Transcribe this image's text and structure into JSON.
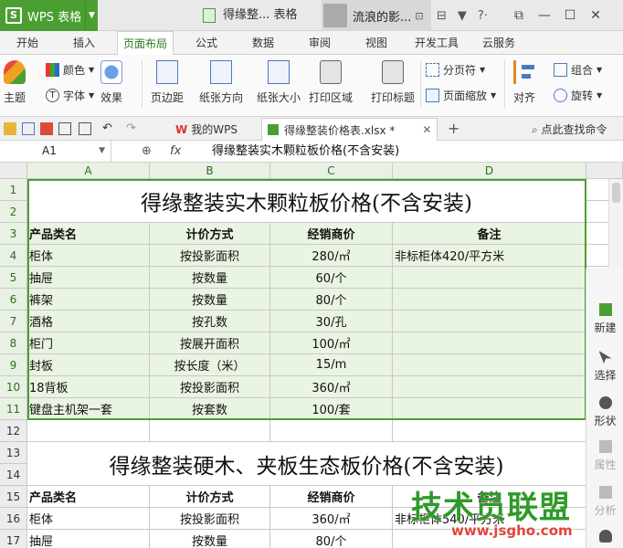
{
  "titlebar": {
    "app_label": "WPS 表格",
    "doc_title": "得缘整... 表格",
    "user_name": "流浪的影...",
    "colors": {
      "brand": "#4b9f32"
    }
  },
  "menu": {
    "tabs": [
      "开始",
      "插入",
      "页面布局",
      "公式",
      "数据",
      "审阅",
      "视图",
      "开发工具",
      "云服务"
    ],
    "active_tab": "页面布局"
  },
  "ribbon": {
    "theme": "主题",
    "colors": "颜色",
    "fonts": "字体",
    "effects": "效果",
    "margins": "页边距",
    "orientation": "纸张方向",
    "paper_size": "纸张大小",
    "print_area": "打印区域",
    "print_titles": "打印标题",
    "page_break": "分页符",
    "page_zoom": "页面缩放",
    "align": "对齐",
    "group": "组合",
    "rotate": "旋转"
  },
  "doc_tabs": {
    "home": "我的WPS",
    "file": "得缘整装价格表.xlsx *",
    "search": "点此查找命令"
  },
  "formula": {
    "name_box": "A1",
    "content": "得缘整装实木颗粒板价格(不含安装)",
    "fx": "fx"
  },
  "grid": {
    "columns": [
      "A",
      "B",
      "C",
      "D"
    ],
    "rows": [
      "1",
      "2",
      "3",
      "4",
      "5",
      "6",
      "7",
      "8",
      "9",
      "10",
      "11",
      "12",
      "13",
      "14",
      "15",
      "16",
      "17"
    ],
    "title1": "得缘整装实木颗粒板价格(不含安装)",
    "title2": "得缘整装硬木、夹板生态板价格(不含安装)",
    "headers": [
      "产品类名",
      "计价方式",
      "经销商价",
      "备注"
    ],
    "table1": [
      [
        "柜体",
        "按投影面积",
        "280/㎡",
        "非标柜体420/平方米"
      ],
      [
        "抽屉",
        "按数量",
        "60/个",
        ""
      ],
      [
        "裤架",
        "按数量",
        "80/个",
        ""
      ],
      [
        "酒格",
        "按孔数",
        "30/孔",
        ""
      ],
      [
        "柜门",
        "按展开面积",
        "100/㎡",
        ""
      ],
      [
        "封板",
        "按长度（米）",
        "15/m",
        ""
      ],
      [
        "18背板",
        "按投影面积",
        "360/㎡",
        ""
      ],
      [
        "键盘主机架一套",
        "按套数",
        "100/套",
        ""
      ]
    ],
    "table2": [
      [
        "柜体",
        "按投影面积",
        "360/㎡",
        "非标柜体540/平方米"
      ],
      [
        "抽屉",
        "按数量",
        "80/个",
        ""
      ]
    ]
  },
  "side_panel": {
    "items": [
      "新建",
      "选择",
      "形状",
      "属性",
      "分析"
    ]
  },
  "watermark": {
    "text": "技术员联盟",
    "url": "www.jsgho.com"
  }
}
